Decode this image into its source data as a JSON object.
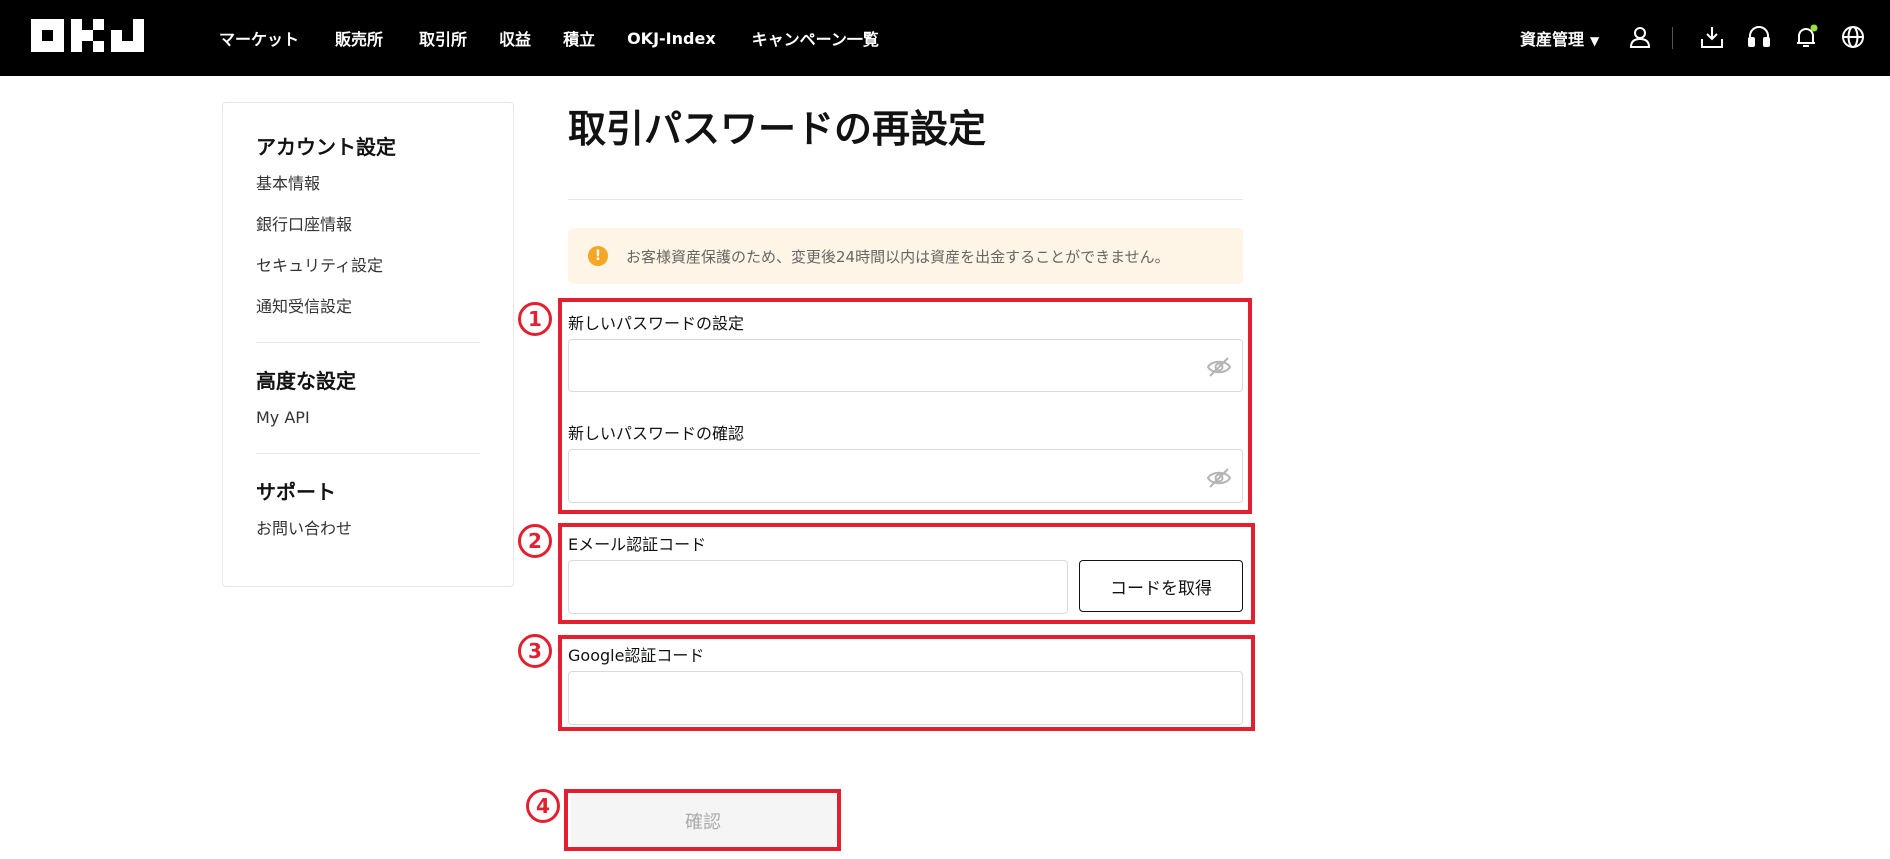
{
  "header": {
    "logo_text": "OKJ",
    "nav": [
      "マーケット",
      "販売所",
      "取引所",
      "収益",
      "積立",
      "OKJ-Index",
      "キャンペーン一覧"
    ],
    "asset_menu": "資産管理",
    "icons": [
      "user-icon",
      "download-icon",
      "headset-icon",
      "bell-icon",
      "globe-icon"
    ],
    "notification_dot_color": "#9be43a"
  },
  "sidebar": {
    "sections": [
      {
        "title": "アカウント設定",
        "items": [
          "基本情報",
          "銀行口座情報",
          "セキュリティ設定",
          "通知受信設定"
        ]
      },
      {
        "title": "高度な設定",
        "items": [
          "My API"
        ]
      },
      {
        "title": "サポート",
        "items": [
          "お問い合わせ"
        ]
      }
    ]
  },
  "main": {
    "title": "取引パスワードの再設定",
    "notice": "お客様資産保護のため、変更後24時間以内は資産を出金することができません。",
    "new_password_label": "新しいパスワードの設定",
    "new_password_value": "",
    "confirm_password_label": "新しいパスワードの確認",
    "confirm_password_value": "",
    "email_code_label": "Eメール認証コード",
    "email_code_value": "",
    "get_code_button": "コードを取得",
    "google_code_label": "Google認証コード",
    "google_code_value": "",
    "confirm_button": "確認"
  },
  "annotations": {
    "markers": [
      "1",
      "2",
      "3",
      "4"
    ],
    "color": "#e3202f"
  }
}
